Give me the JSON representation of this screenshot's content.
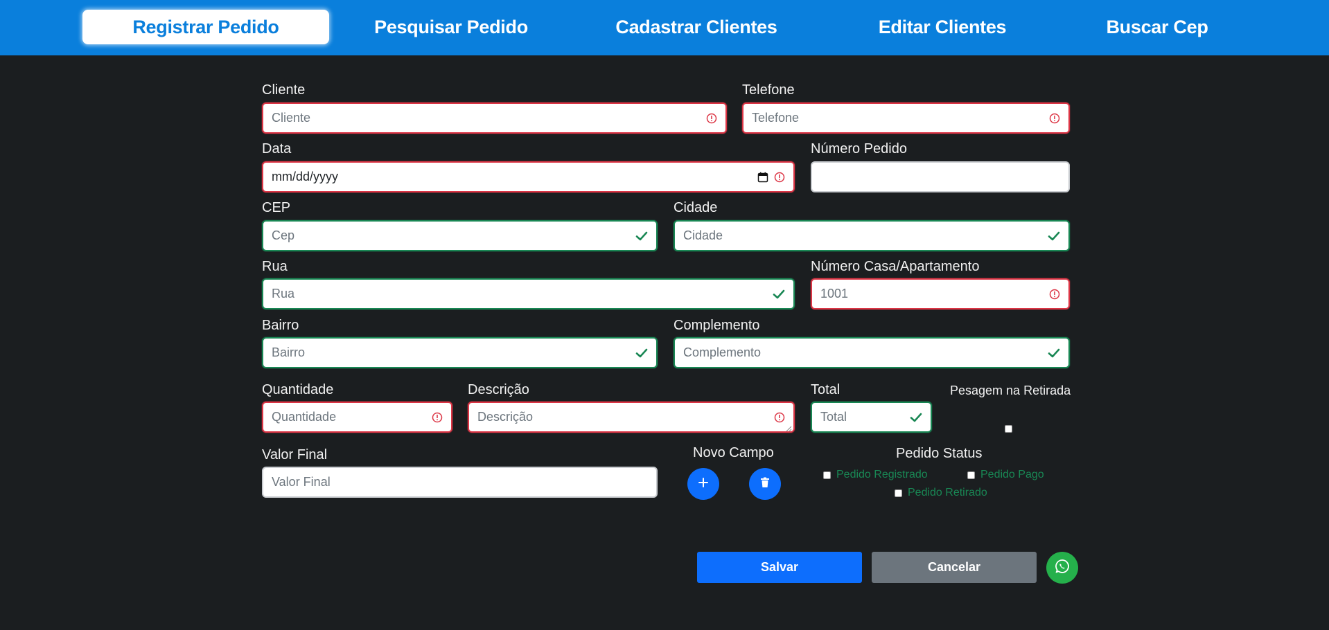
{
  "nav": {
    "items": [
      {
        "label": "Registrar Pedido",
        "active": true
      },
      {
        "label": "Pesquisar Pedido",
        "active": false
      },
      {
        "label": "Cadastrar Clientes",
        "active": false
      },
      {
        "label": "Editar Clientes",
        "active": false
      },
      {
        "label": "Buscar Cep",
        "active": false
      }
    ]
  },
  "form": {
    "cliente": {
      "label": "Cliente",
      "placeholder": "Cliente",
      "state": "invalid"
    },
    "telefone": {
      "label": "Telefone",
      "placeholder": "Telefone",
      "state": "invalid"
    },
    "data": {
      "label": "Data",
      "value": "mm/dd/yyyy",
      "state": "invalid"
    },
    "numero_pedido": {
      "label": "Número Pedido",
      "placeholder": ""
    },
    "cep": {
      "label": "CEP",
      "placeholder": "Cep",
      "state": "valid"
    },
    "cidade": {
      "label": "Cidade",
      "placeholder": "Cidade",
      "state": "valid"
    },
    "rua": {
      "label": "Rua",
      "placeholder": "Rua",
      "state": "valid"
    },
    "numero_casa": {
      "label": "Número Casa/Apartamento",
      "placeholder": "1001",
      "state": "invalid"
    },
    "bairro": {
      "label": "Bairro",
      "placeholder": "Bairro",
      "state": "valid"
    },
    "complemento": {
      "label": "Complemento",
      "placeholder": "Complemento",
      "state": "valid"
    },
    "quantidade": {
      "label": "Quantidade",
      "placeholder": "Quantidade",
      "state": "invalid"
    },
    "descricao": {
      "label": "Descrição",
      "placeholder": "Descrição",
      "state": "invalid"
    },
    "total": {
      "label": "Total",
      "placeholder": "Total",
      "state": "valid"
    },
    "pesagem": {
      "label": "Pesagem na Retirada",
      "checked": false
    },
    "valor_final": {
      "label": "Valor Final",
      "placeholder": "Valor Final"
    },
    "novo_campo": {
      "label": "Novo Campo",
      "add_icon": "plus-icon",
      "remove_icon": "trash-icon"
    },
    "pedido_status": {
      "title": "Pedido Status",
      "options": [
        {
          "label": "Pedido Registrado",
          "checked": false
        },
        {
          "label": "Pedido Pago",
          "checked": false
        },
        {
          "label": "Pedido Retirado",
          "checked": false
        }
      ]
    }
  },
  "actions": {
    "save_label": "Salvar",
    "cancel_label": "Cancelar",
    "whatsapp_icon": "whatsapp-icon"
  },
  "colors": {
    "nav_bg": "#0a7fdc",
    "page_bg": "#1b1e20",
    "invalid": "#dc3545",
    "valid": "#198754",
    "primary": "#0d6efd",
    "secondary": "#6c757d",
    "whatsapp": "#25b04b"
  }
}
